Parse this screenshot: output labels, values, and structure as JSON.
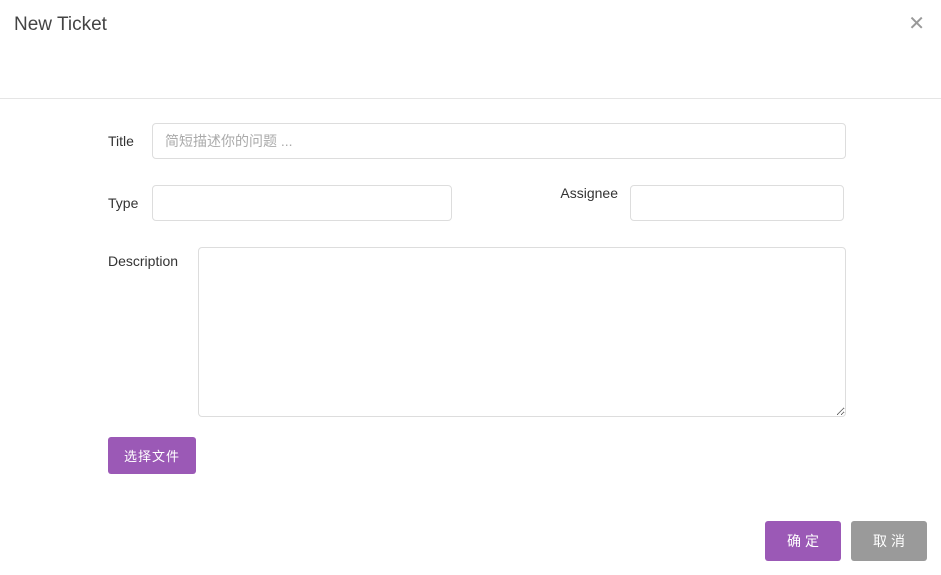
{
  "header": {
    "title": "New Ticket"
  },
  "form": {
    "title_label": "Title",
    "title_placeholder": "简短描述你的问题 ...",
    "title_value": "",
    "type_label": "Type",
    "type_value": "",
    "assignee_label": "Assignee",
    "assignee_value": "",
    "description_label": "Description",
    "description_value": "",
    "choose_file_label": "选择文件"
  },
  "footer": {
    "confirm_label": "确定",
    "cancel_label": "取消"
  }
}
